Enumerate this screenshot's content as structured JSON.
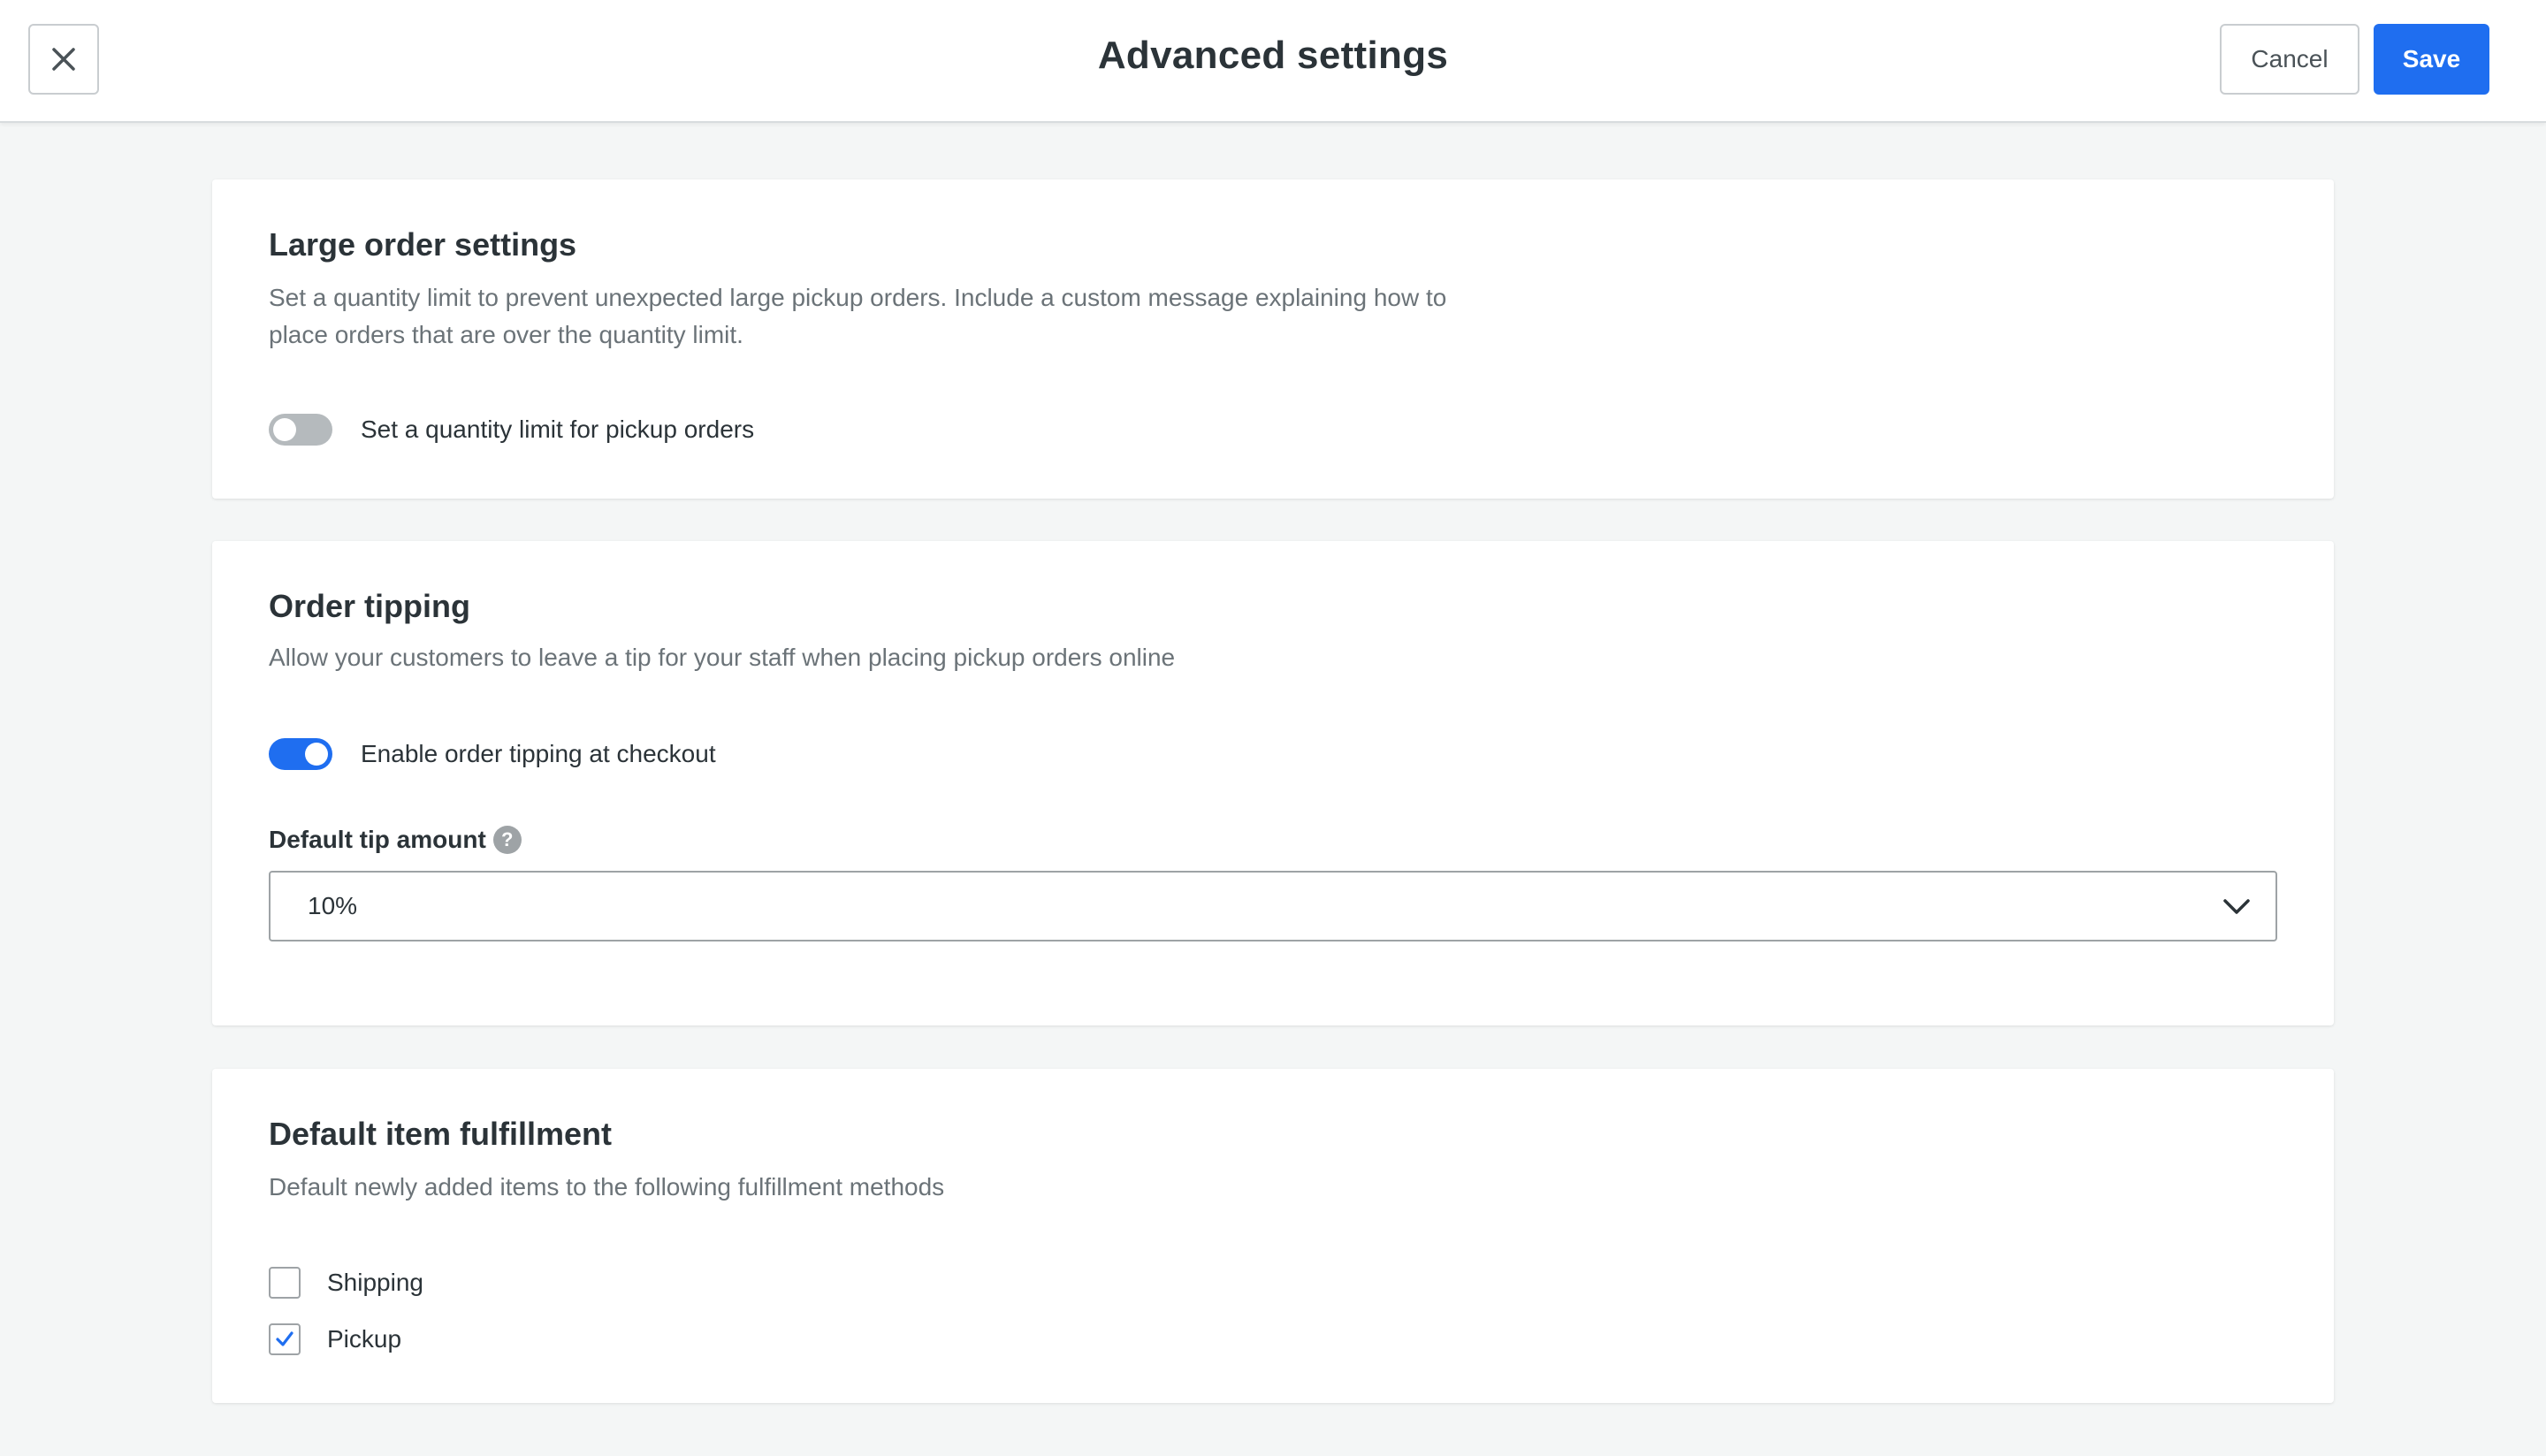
{
  "header": {
    "title": "Advanced settings",
    "cancel_label": "Cancel",
    "save_label": "Save"
  },
  "large_order": {
    "title": "Large order settings",
    "description_line1": "Set a quantity limit to prevent unexpected large pickup orders. Include a custom message explaining how to",
    "description_line2": "place orders that are over the quantity limit.",
    "toggle_label": "Set a quantity limit for pickup orders",
    "toggle_on": false
  },
  "order_tipping": {
    "title": "Order tipping",
    "description": "Allow your customers to leave a tip for your staff when placing pickup orders online",
    "toggle_label": "Enable order tipping at checkout",
    "toggle_on": true,
    "default_tip_label": "Default tip amount",
    "default_tip_value": "10%",
    "help_glyph": "?"
  },
  "fulfillment": {
    "title": "Default item fulfillment",
    "description": "Default newly added items to the following fulfillment methods",
    "options": [
      {
        "label": "Shipping",
        "checked": false
      },
      {
        "label": "Pickup",
        "checked": true
      }
    ]
  },
  "colors": {
    "accent": "#1f6ef0",
    "background": "#f4f6f6",
    "toggle_off": "#b5babd"
  },
  "icons": {
    "close": "close-icon",
    "help": "help-icon",
    "chevron": "chevron-down-icon",
    "check": "check-icon"
  }
}
